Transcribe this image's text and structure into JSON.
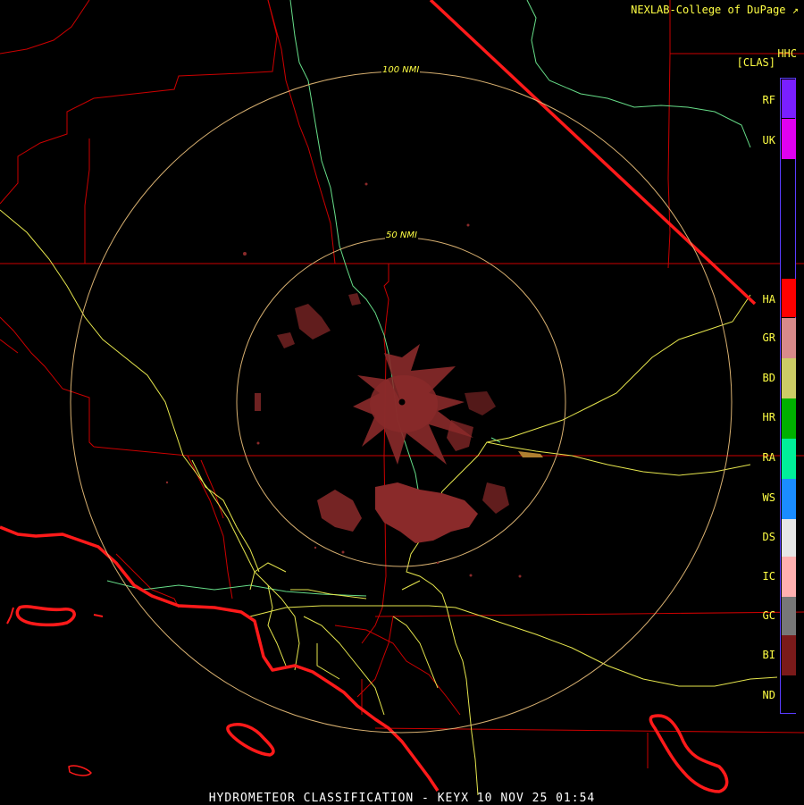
{
  "credit": "NEXLAB-College of DuPage",
  "product_code": "HHC",
  "legend_title": "[CLAS]",
  "caption": "HYDROMETEOR CLASSIFICATION - KEYX 10 NOV 25 01:54",
  "range_rings": [
    "50 NMI",
    "100 NMI"
  ],
  "legend": [
    {
      "code": "RF",
      "color": "#7a1fff"
    },
    {
      "code": "UK",
      "color": "#e000f0"
    },
    {
      "code": "HA",
      "color": "#ff0000"
    },
    {
      "code": "GR",
      "color": "#d88a8a"
    },
    {
      "code": "BD",
      "color": "#cccc66"
    },
    {
      "code": "HR",
      "color": "#00b000"
    },
    {
      "code": "RA",
      "color": "#00ee99"
    },
    {
      "code": "WS",
      "color": "#1a8cff"
    },
    {
      "code": "DS",
      "color": "#e6e6e6"
    },
    {
      "code": "IC",
      "color": "#ffb0b0"
    },
    {
      "code": "GC",
      "color": "#777777"
    },
    {
      "code": "BI",
      "color": "#7a1a1a"
    },
    {
      "code": "ND",
      "color": "#000000"
    }
  ],
  "colors": {
    "background": "#000000",
    "county_lines": "#cc0000",
    "coastline": "#ff1a1a",
    "highways": "#e6e64d",
    "rivers": "#66dd88",
    "range_rings": "#d8b070",
    "echo": "#8a2a2a"
  }
}
